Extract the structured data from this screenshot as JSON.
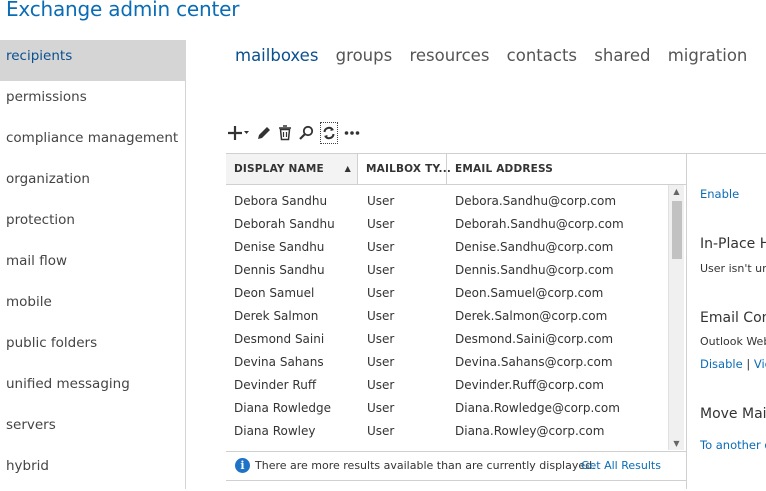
{
  "app": {
    "title": "Exchange admin center"
  },
  "sidebar": {
    "items": [
      {
        "label": "recipients",
        "active": true
      },
      {
        "label": "permissions"
      },
      {
        "label": "compliance management"
      },
      {
        "label": "organization"
      },
      {
        "label": "protection"
      },
      {
        "label": "mail flow"
      },
      {
        "label": "mobile"
      },
      {
        "label": "public folders"
      },
      {
        "label": "unified messaging"
      },
      {
        "label": "servers"
      },
      {
        "label": "hybrid"
      }
    ]
  },
  "topnav": {
    "tabs": [
      {
        "label": "mailboxes",
        "active": true
      },
      {
        "label": "groups"
      },
      {
        "label": "resources"
      },
      {
        "label": "contacts"
      },
      {
        "label": "shared"
      },
      {
        "label": "migration"
      }
    ]
  },
  "toolbar": {
    "icons": [
      "add-icon",
      "edit-icon",
      "delete-icon",
      "search-icon",
      "refresh-icon",
      "more-icon"
    ]
  },
  "grid": {
    "headers": [
      "DISPLAY NAME",
      "MAILBOX TY...",
      "EMAIL ADDRESS"
    ],
    "sort_indicator": "▲",
    "rows": [
      [
        "Debora Sandhu",
        "User",
        "Debora.Sandhu@corp.com"
      ],
      [
        "Deborah Sandhu",
        "User",
        "Deborah.Sandhu@corp.com"
      ],
      [
        "Denise Sandhu",
        "User",
        "Denise.Sandhu@corp.com"
      ],
      [
        "Dennis Sandhu",
        "User",
        "Dennis.Sandhu@corp.com"
      ],
      [
        "Deon Samuel",
        "User",
        "Deon.Samuel@corp.com"
      ],
      [
        "Derek Salmon",
        "User",
        "Derek.Salmon@corp.com"
      ],
      [
        "Desmond Saini",
        "User",
        "Desmond.Saini@corp.com"
      ],
      [
        "Devina Sahans",
        "User",
        "Devina.Sahans@corp.com"
      ],
      [
        "Devinder Ruff",
        "User",
        "Devinder.Ruff@corp.com"
      ],
      [
        "Diana Rowledge",
        "User",
        "Diana.Rowledge@corp.com"
      ],
      [
        "Diana Rowley",
        "User",
        "Diana.Rowley@corp.com"
      ]
    ],
    "footer_text": "There are more results available than are currently displayed.",
    "footer_link": "Get All Results"
  },
  "details": {
    "enable_link": "Enable",
    "inplace_heading": "In-Place Ho",
    "inplace_text": "User isn't und",
    "email_conn_heading": "Email Conn",
    "outlook_text": "Outlook Web",
    "disable_link": "Disable",
    "separator": "|",
    "view_link": "View",
    "move_heading": "Move Mail",
    "another_link": "To another d"
  }
}
